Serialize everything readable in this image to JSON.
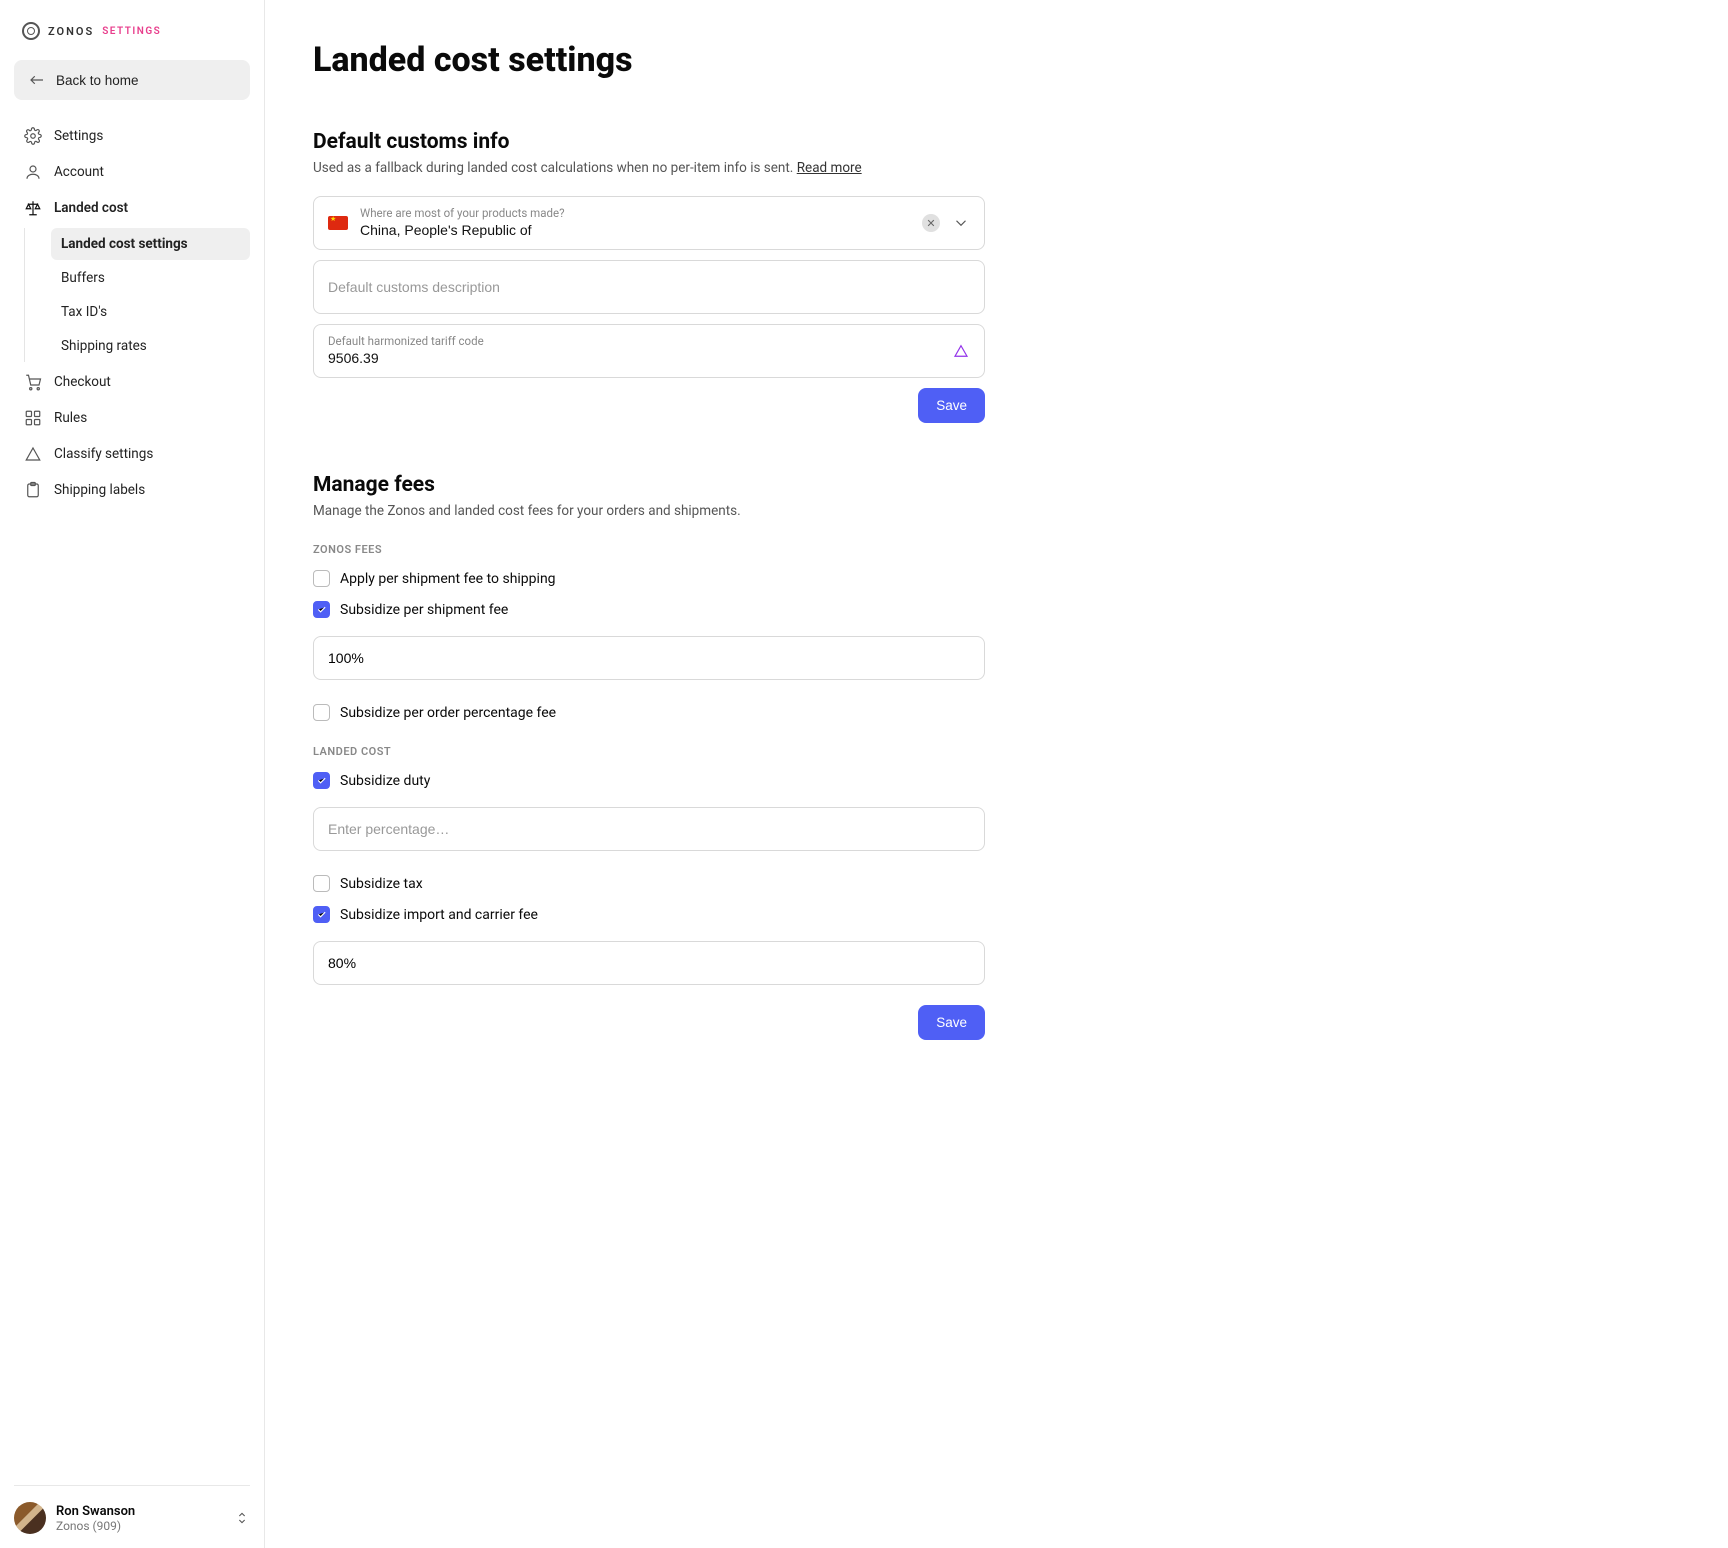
{
  "brand": {
    "name": "ZONOS",
    "sub": "SETTINGS"
  },
  "sidebar": {
    "back": "Back to home",
    "items": [
      {
        "label": "Settings"
      },
      {
        "label": "Account"
      },
      {
        "label": "Landed cost",
        "children": [
          {
            "label": "Landed cost settings"
          },
          {
            "label": "Buffers"
          },
          {
            "label": "Tax ID's"
          },
          {
            "label": "Shipping rates"
          }
        ]
      },
      {
        "label": "Checkout"
      },
      {
        "label": "Rules"
      },
      {
        "label": "Classify settings"
      },
      {
        "label": "Shipping labels"
      }
    ]
  },
  "user": {
    "name": "Ron Swanson",
    "org": "Zonos (909)"
  },
  "page": {
    "title": "Landed cost settings",
    "section1": {
      "heading": "Default customs info",
      "desc": "Used as a fallback during landed cost calculations when no per-item info is sent. ",
      "readmore": "Read more",
      "origin_label": "Where are most of your products made?",
      "origin_value": "China, People's Republic of",
      "customs_desc_placeholder": "Default customs description",
      "tariff_label": "Default harmonized tariff code",
      "tariff_value": "9506.39",
      "save": "Save"
    },
    "section2": {
      "heading": "Manage fees",
      "desc": "Manage the Zonos and landed cost fees for your orders and shipments.",
      "zonos_head": "ZONOS FEES",
      "opt_apply_shipment": "Apply per shipment fee to shipping",
      "opt_sub_shipment": "Subsidize per shipment fee",
      "sub_shipment_value": "100%",
      "opt_sub_order_pct": "Subsidize per order percentage fee",
      "landed_head": "LANDED COST",
      "opt_sub_duty": "Subsidize duty",
      "duty_placeholder": "Enter percentage…",
      "opt_sub_tax": "Subsidize tax",
      "opt_sub_import": "Subsidize import and carrier fee",
      "import_value": "80%",
      "save": "Save"
    }
  }
}
